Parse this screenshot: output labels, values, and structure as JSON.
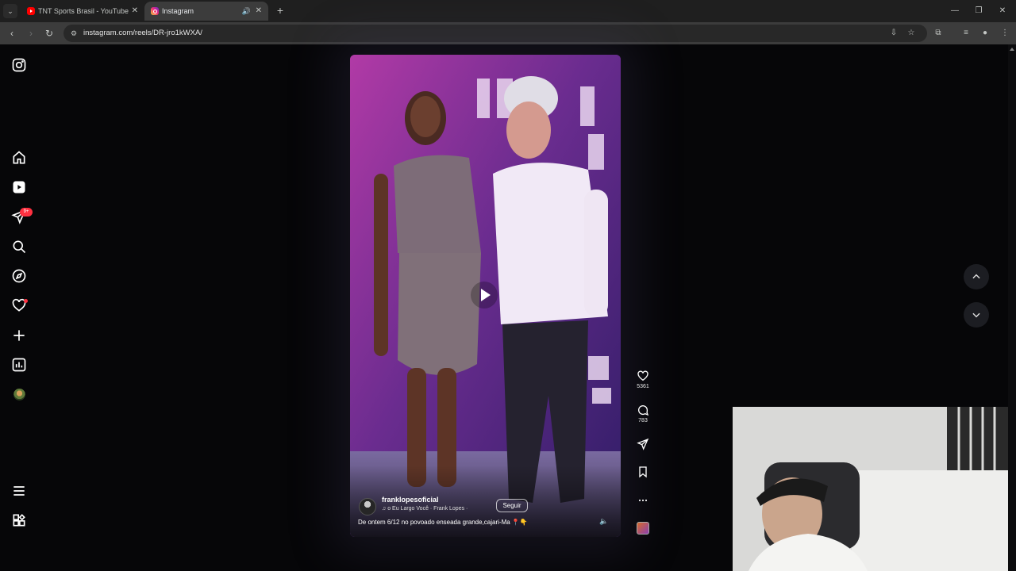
{
  "browser": {
    "tabs": [
      {
        "title": "TNT Sports Brasil - YouTube",
        "favicon": "youtube-icon",
        "active": false
      },
      {
        "title": "Instagram",
        "favicon": "instagram-icon",
        "active": true,
        "audio": "speaker-icon"
      }
    ],
    "new_tab_label": "+",
    "address_bar": {
      "url": "instagram.com/reels/DR-jro1kWXA/"
    },
    "icons": {
      "back": "‹",
      "forward": "›",
      "reload": "↻",
      "install": "⇩",
      "bookmark": "☆",
      "extensions": "⧉",
      "media": "≡",
      "profile": "●",
      "menu": "⋮",
      "minimize": "—",
      "maximize": "❐",
      "close": "✕"
    }
  },
  "sidebar": {
    "items": [
      {
        "name": "instagram-logo",
        "icon": "instagram-icon"
      },
      {
        "name": "home",
        "icon": "home-icon"
      },
      {
        "name": "reels",
        "icon": "reels-icon"
      },
      {
        "name": "messages",
        "icon": "messages-icon",
        "badge": "9+"
      },
      {
        "name": "search",
        "icon": "search-icon"
      },
      {
        "name": "explore",
        "icon": "explore-icon"
      },
      {
        "name": "notifications",
        "icon": "heart-icon"
      },
      {
        "name": "create",
        "icon": "plus-icon"
      },
      {
        "name": "dashboard",
        "icon": "dashboard-icon"
      },
      {
        "name": "profile",
        "icon": "avatar"
      },
      {
        "name": "more",
        "icon": "menu-icon"
      },
      {
        "name": "also-from-meta",
        "icon": "meta-icon"
      }
    ],
    "messages_badge": "9+"
  },
  "reel": {
    "author": "franklopesoficial",
    "audio": "o Eu Largo Você · Frank Lopes ·",
    "follow_label": "Seguir",
    "caption": "De ontem 6/12 no povoado enseada grande,cajari-Ma 📍👇",
    "mute_icon": "🔈"
  },
  "actions": {
    "likes": "5361",
    "comments": "783"
  },
  "colors": {
    "accent_red": "#ff3040",
    "page_bg": "#060608",
    "chrome_bg": "#1f1f1f"
  }
}
